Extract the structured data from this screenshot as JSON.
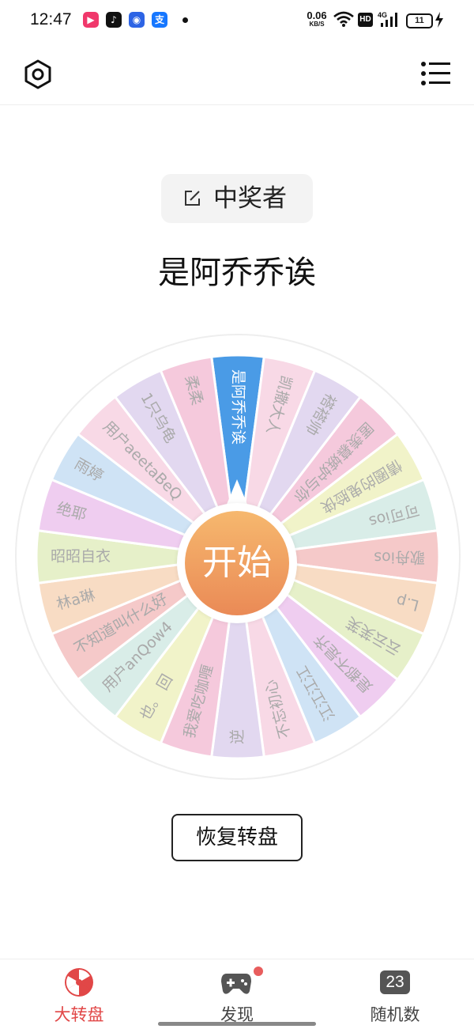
{
  "status_bar": {
    "time": "12:47",
    "notification_icons": [
      {
        "name": "video-app-icon",
        "color": "#f0386b",
        "glyph": "▶"
      },
      {
        "name": "tiktok-icon",
        "color": "#111111",
        "glyph": "♪"
      },
      {
        "name": "baidu-icon",
        "color": "#2d64e5",
        "glyph": "◉"
      },
      {
        "name": "alipay-icon",
        "color": "#1677ff",
        "glyph": "支"
      }
    ],
    "net_speed": "0.06",
    "net_speed_unit": "KB/S",
    "hd_label": "HD",
    "network_type": "4G",
    "battery": "11"
  },
  "header": {
    "settings_icon": "hexagon-settings-icon",
    "menu_icon": "list-menu-icon"
  },
  "winner": {
    "chip_label": "中奖者",
    "name": "是阿乔乔诶"
  },
  "wheel": {
    "start_label": "开始",
    "highlight_color": "#4a9be6",
    "segments": [
      {
        "label": "是阿乔乔诶",
        "color": "#4a9be6",
        "selected": true
      },
      {
        "label": "凯撒大人",
        "color": "#f8d9e6"
      },
      {
        "label": "褡褡帅",
        "color": "#e2d8f0"
      },
      {
        "label": "匿羡慕嫉妒与你",
        "color": "#f5c9dc"
      },
      {
        "label": "情圈的鬼脸侠",
        "color": "#f1f3c9"
      },
      {
        "label": "可可ios",
        "color": "#d9ede8"
      },
      {
        "label": "歌舟ios",
        "color": "#f5c9c9"
      },
      {
        "label": "L.p",
        "color": "#f8dcc4"
      },
      {
        "label": "云云芙芙",
        "color": "#e6f0c9"
      },
      {
        "label": "是都不是齐",
        "color": "#efcdf0"
      },
      {
        "label": "江江江江",
        "color": "#cfe3f5"
      },
      {
        "label": "不忘初心",
        "color": "#f8d9e6"
      },
      {
        "label": "逆",
        "color": "#e2d8f0"
      },
      {
        "label": "我爱吃咖喱",
        "color": "#f5c9dc"
      },
      {
        "label": "也。 回",
        "color": "#f1f3c9"
      },
      {
        "label": "用户anQow4",
        "color": "#d9ede8"
      },
      {
        "label": "不知道叫什么好",
        "color": "#f5c9c9"
      },
      {
        "label": "林a琳",
        "color": "#f8dcc4"
      },
      {
        "label": "昭昭自衣",
        "color": "#e6f0c9"
      },
      {
        "label": "绝耶",
        "color": "#efcdf0"
      },
      {
        "label": "雨婷",
        "color": "#cfe3f5"
      },
      {
        "label": "用户aeetaBeQ",
        "color": "#f8d9e6"
      },
      {
        "label": "1只乌龟",
        "color": "#e2d8f0"
      },
      {
        "label": "柔柔",
        "color": "#f5c9dc"
      }
    ]
  },
  "reset_label": "恢复转盘",
  "bottom_nav": {
    "items": [
      {
        "label": "大转盘",
        "active": true
      },
      {
        "label": "发现",
        "active": false,
        "badge": true
      },
      {
        "label": "随机数",
        "active": false,
        "icon_text": "23"
      }
    ],
    "active_color": "#e14747"
  }
}
